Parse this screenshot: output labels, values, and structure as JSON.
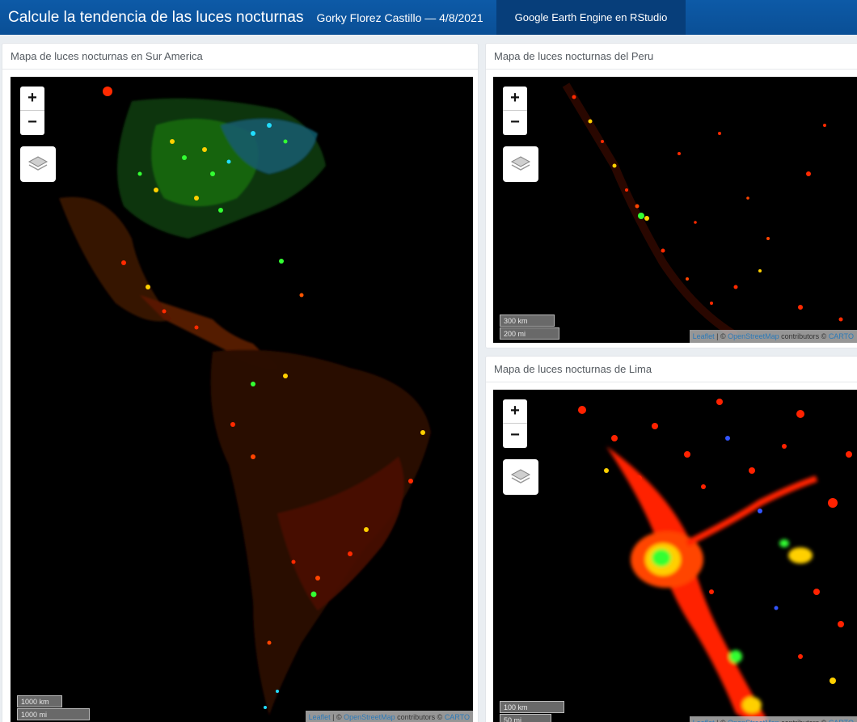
{
  "navbar": {
    "title": "Calcule la tendencia de las luces nocturnas",
    "author": "Gorky Florez Castillo — 4/8/2021",
    "tab": "Google Earth Engine en RStudio"
  },
  "panels": {
    "southamerica": {
      "title": "Mapa de luces nocturnas en Sur America",
      "scale_km": "1000 km",
      "scale_mi": "1000 mi"
    },
    "peru": {
      "title": "Mapa de luces nocturnas del Peru",
      "scale_km": "300 km",
      "scale_mi": "200 mi"
    },
    "lima": {
      "title": "Mapa de luces nocturnas de Lima",
      "scale_km": "100 km",
      "scale_mi": "50 mi"
    }
  },
  "map_controls": {
    "zoom_in": "+",
    "zoom_out": "−"
  },
  "attribution": {
    "leaflet": "Leaflet",
    "sep": " | © ",
    "osm": "OpenStreetMap",
    "contrib": " contributors © ",
    "carto": "CARTO"
  },
  "colors": {
    "navbar": "#0b55a0",
    "active_tab": "#073e7a",
    "map_background": "#000000",
    "light_red": "#ff2a00",
    "light_yellow": "#ffd000",
    "light_green": "#33ff33",
    "light_cyan": "#22ddff"
  },
  "icons": {
    "layers_control": "layers-icon"
  }
}
